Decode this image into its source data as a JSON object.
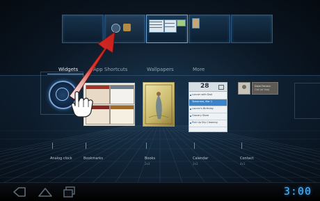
{
  "customize_tabs": [
    {
      "label": "Widgets",
      "selected": true
    },
    {
      "label": "App Shortcuts",
      "selected": false
    },
    {
      "label": "Wallpapers",
      "selected": false
    },
    {
      "label": "More",
      "selected": false
    }
  ],
  "widgets": [
    {
      "label": "Analog clock",
      "size": ""
    },
    {
      "label": "Bookmarks",
      "size": ""
    },
    {
      "label": "Books",
      "size": "2x3"
    },
    {
      "label": "Calendar",
      "size": "2x3"
    },
    {
      "label": "Contact",
      "size": "4x1"
    }
  ],
  "calendar": {
    "date": "28",
    "events": [
      "Lunner with Dad",
      "Tomorrow, Mar 1",
      "Lauren's Birthday",
      "Grocery Store",
      "Pick Up Dry Cleaning"
    ]
  },
  "contact": {
    "lines": [
      "Dave Ferrera",
      "Call (of Voo)"
    ]
  },
  "system_bar": {
    "time": "3:00"
  },
  "colors": {
    "accent": "#4fb6ff",
    "arrow": "#d8322c"
  }
}
